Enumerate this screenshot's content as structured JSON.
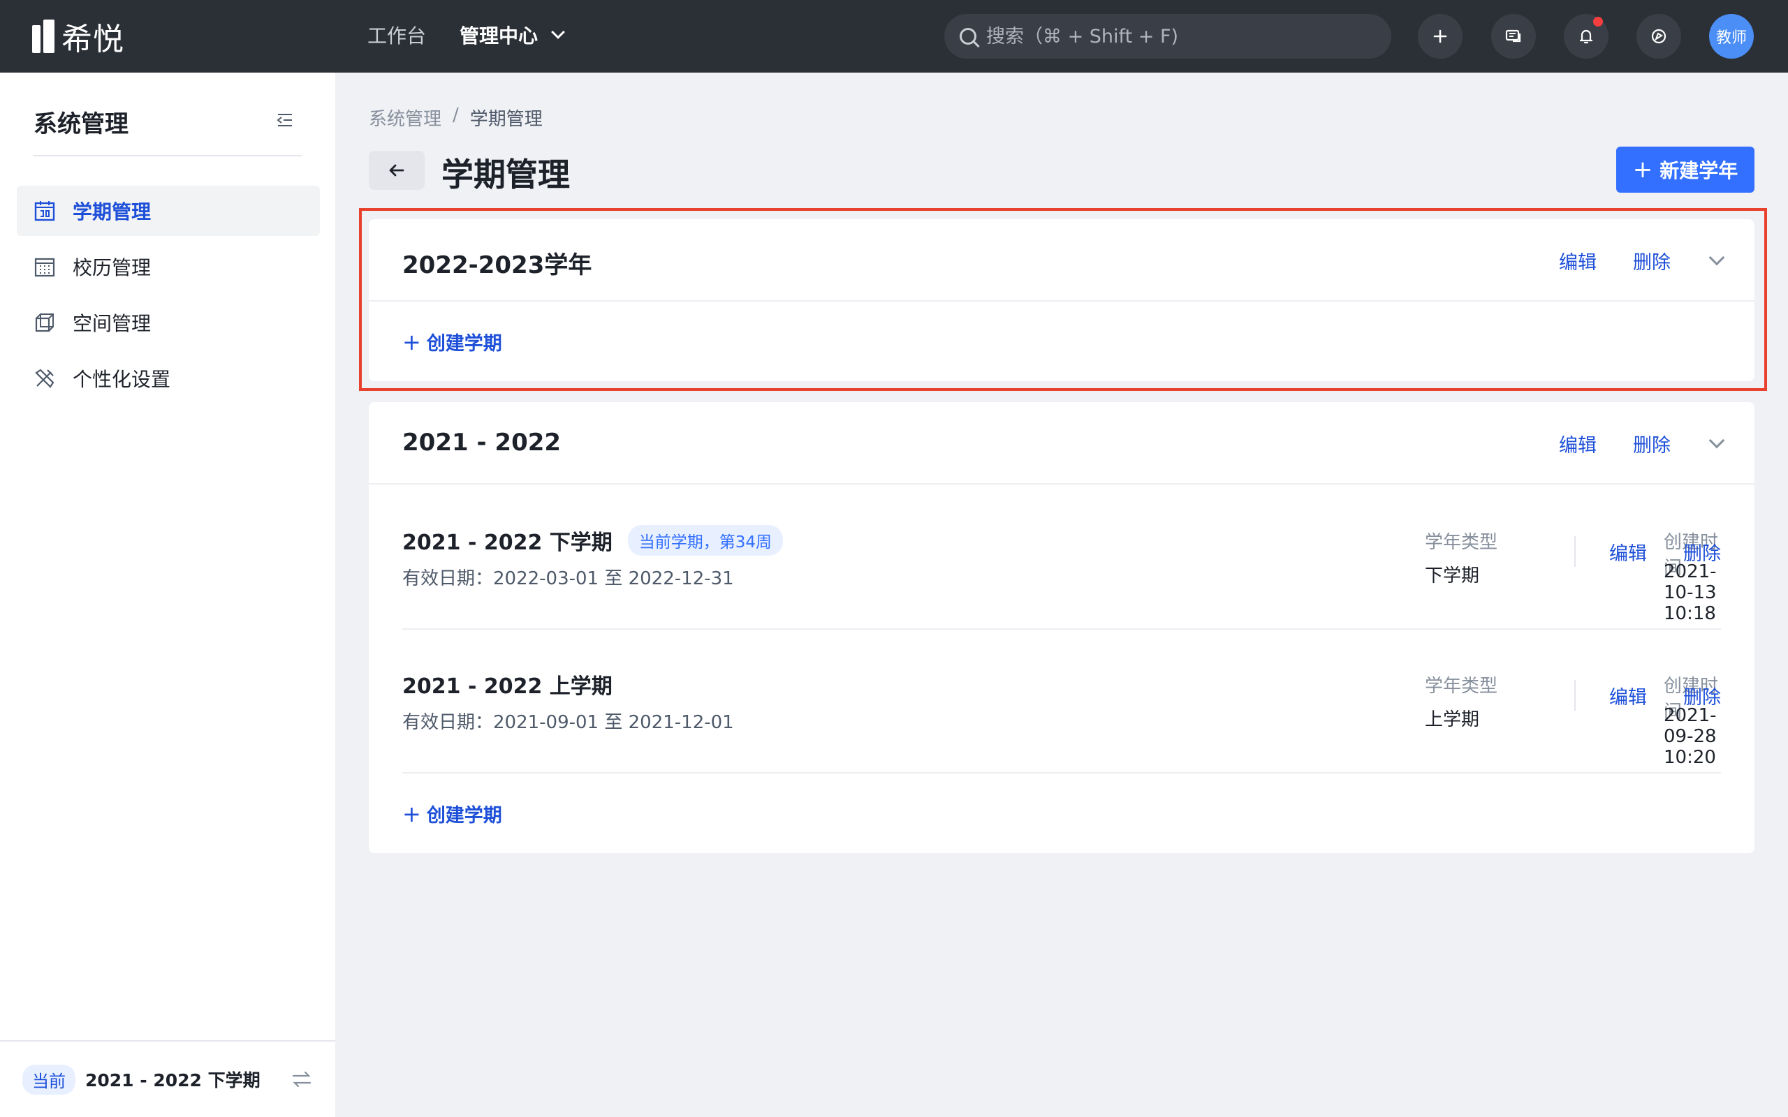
{
  "app": {
    "logo_text": "希悦",
    "nav": [
      {
        "label": "工作台"
      },
      {
        "label": "管理中心"
      }
    ],
    "search_placeholder": "搜索（⌘ + Shift + F)",
    "avatar_label": "教师",
    "icons": [
      "plus-icon",
      "chat-icon",
      "bell-icon",
      "compass-icon"
    ]
  },
  "sidebar": {
    "title": "系统管理",
    "items": [
      {
        "label": "学期管理",
        "icon": "calendar-icon",
        "active": true
      },
      {
        "label": "校历管理",
        "icon": "grid-calendar-icon",
        "active": false
      },
      {
        "label": "空间管理",
        "icon": "cube-icon",
        "active": false
      },
      {
        "label": "个性化设置",
        "icon": "tools-icon",
        "active": false
      }
    ],
    "footer": {
      "badge": "当前",
      "term": "2021 - 2022 下学期"
    }
  },
  "main": {
    "breadcrumb": [
      "系统管理",
      "/",
      "学期管理"
    ],
    "title": "学期管理",
    "new_year_button": "新建学年",
    "accent_color": "#3370ff",
    "highlight_color": "#e8412e",
    "years": [
      {
        "title": "2022-2023学年",
        "edit": "编辑",
        "delete": "删除",
        "create_term": "创建学期"
      },
      {
        "title": "2021 - 2022",
        "edit": "编辑",
        "delete": "删除",
        "create_term": "创建学期",
        "terms": [
          {
            "name": "2021 - 2022 下学期",
            "badge": "当前学期，第34周",
            "dates": "有效日期：2022-03-01 至 2022-12-31",
            "type_label": "学年类型",
            "type_value": "下学期",
            "created_label": "创建时间",
            "created_value": "2021-10-13 10:18",
            "edit": "编辑",
            "delete": "删除"
          },
          {
            "name": "2021 - 2022 上学期",
            "dates": "有效日期：2021-09-01 至 2021-12-01",
            "type_label": "学年类型",
            "type_value": "上学期",
            "created_label": "创建时间",
            "created_value": "2021-09-28 10:20",
            "edit": "编辑",
            "delete": "删除"
          }
        ]
      }
    ]
  }
}
